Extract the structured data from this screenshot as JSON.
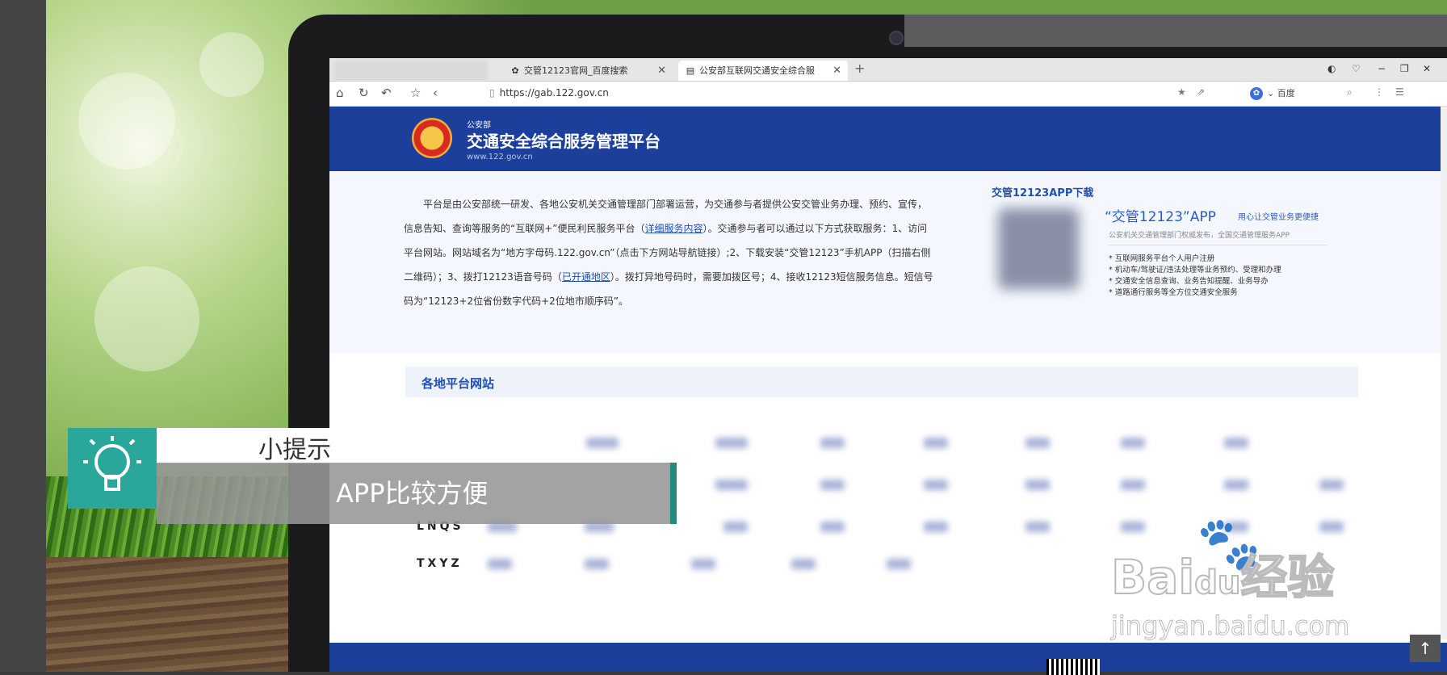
{
  "browser": {
    "tabs": [
      {
        "label": "交管12123官网_百度搜索",
        "icon": "paw-icon"
      },
      {
        "label": "公安部互联网交通安全综合服",
        "icon": "page-icon",
        "active": true
      }
    ],
    "new_tab": "+",
    "url": "https://gab.122.gov.cn",
    "search_engine": "百度"
  },
  "site": {
    "org_small": "公安部",
    "title": "交通安全综合服务管理平台",
    "domain": "www.122.gov.cn",
    "intro_lines": [
      "平台是由公安部统一研发、各地公安机关交通管理部门部署运营，为交通参与者提供公安交管业务办理、",
      "预约、宣传，信息告知、查询等服务的“互联网+”便民利民服务平台（",
      "详细服务内容",
      "）。交通参与者可以通",
      "过以下方式获取服务：1、访问平台网站。网站域名为“地方字母码.122.gov.cn”（点击下方网站导航链",
      "接）;2、下载安装“交管12123”手机APP（扫描右侧二维码）；3、拨打12123语音号码（",
      "已开通地区",
      "）。",
      "拨打异地号码时，需要加拨区号；4、接收12123短信服务信息。短信号码为“12123+2位省份数字代码+2",
      "位地市顺序码”。"
    ],
    "app": {
      "section_title": "交管12123APP下载",
      "name": "“交管12123”APP",
      "slogan": "用心让交管业务更便捷",
      "subtitle": "公安机关交通管理部门权威发布，全国交通管理服务APP",
      "features": [
        "* 互联网服务平台个人用户注册",
        "* 机动车/驾驶证/违法处理等业务预约、受理和办理",
        "* 交通安全信息查询、业务告知提醒、业务导办",
        "* 道路通行服务等全方位交通安全服务"
      ]
    },
    "regional_title": "各地平台网站",
    "row_labels": [
      "LNQS",
      "TXYZ"
    ]
  },
  "tip": {
    "title": "小提示",
    "text": "APP比较方便"
  },
  "watermark": {
    "brand_a": "Bai",
    "brand_b": "du",
    "brand_c": "经验",
    "url": "jingyan.baidu.com"
  },
  "colors": {
    "gov_blue": "#1d3f9c",
    "tip_teal": "#2aa79a",
    "link_blue": "#1f4fb6"
  }
}
